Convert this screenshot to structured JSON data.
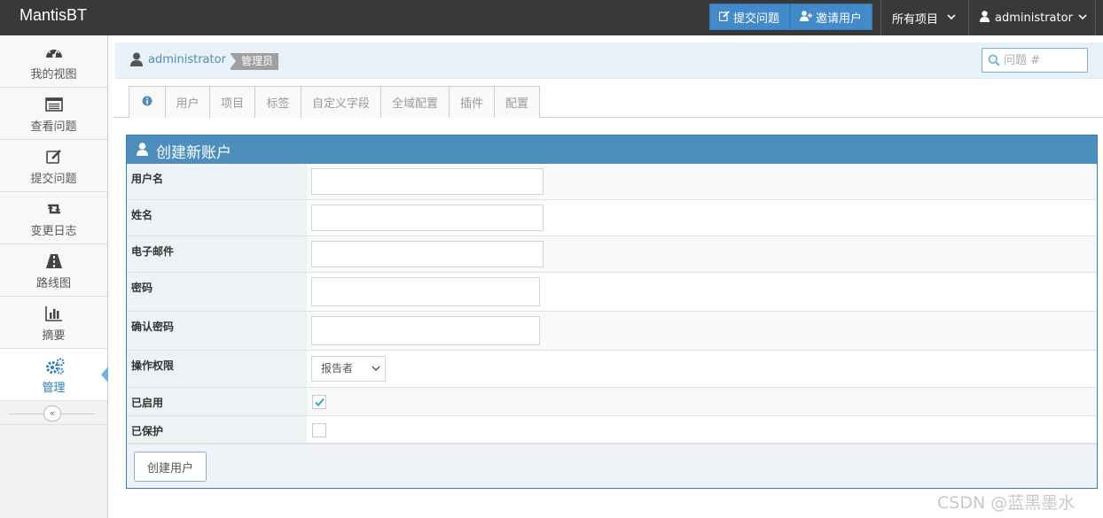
{
  "navbar": {
    "brand": "MantisBT",
    "report_issue": "提交问题",
    "invite_user": "邀请用户",
    "all_projects": "所有项目",
    "user": "administrator"
  },
  "sidebar": {
    "items": [
      {
        "label": "我的视图",
        "icon": "tachometer-icon"
      },
      {
        "label": "查看问题",
        "icon": "list-icon"
      },
      {
        "label": "提交问题",
        "icon": "edit-icon"
      },
      {
        "label": "变更日志",
        "icon": "retweet-icon"
      },
      {
        "label": "路线图",
        "icon": "road-icon"
      },
      {
        "label": "摘要",
        "icon": "bar-chart-icon"
      },
      {
        "label": "管理",
        "icon": "gears-icon"
      }
    ],
    "active_index": 6
  },
  "breadcrumbs": {
    "user": "administrator",
    "role": "管理员",
    "search_placeholder": "问题 #"
  },
  "tabs": [
    "用户",
    "项目",
    "标签",
    "自定义字段",
    "全域配置",
    "插件",
    "配置"
  ],
  "form": {
    "title": "创建新账户",
    "fields": {
      "username": {
        "label": "用户名",
        "value": ""
      },
      "realname": {
        "label": "姓名",
        "value": ""
      },
      "email": {
        "label": "电子邮件",
        "value": ""
      },
      "password": {
        "label": "密码",
        "value": ""
      },
      "password_confirm": {
        "label": "确认密码",
        "value": ""
      },
      "access_level": {
        "label": "操作权限",
        "selected": "报告者"
      },
      "enabled": {
        "label": "已启用",
        "checked": true
      },
      "protected": {
        "label": "已保护",
        "checked": false
      }
    },
    "submit_label": "创建用户"
  },
  "colors": {
    "navbar": "#393939",
    "primary": "#428bca",
    "widget_header": "#4c8fbd"
  },
  "watermark": "CSDN @蓝黑墨水"
}
